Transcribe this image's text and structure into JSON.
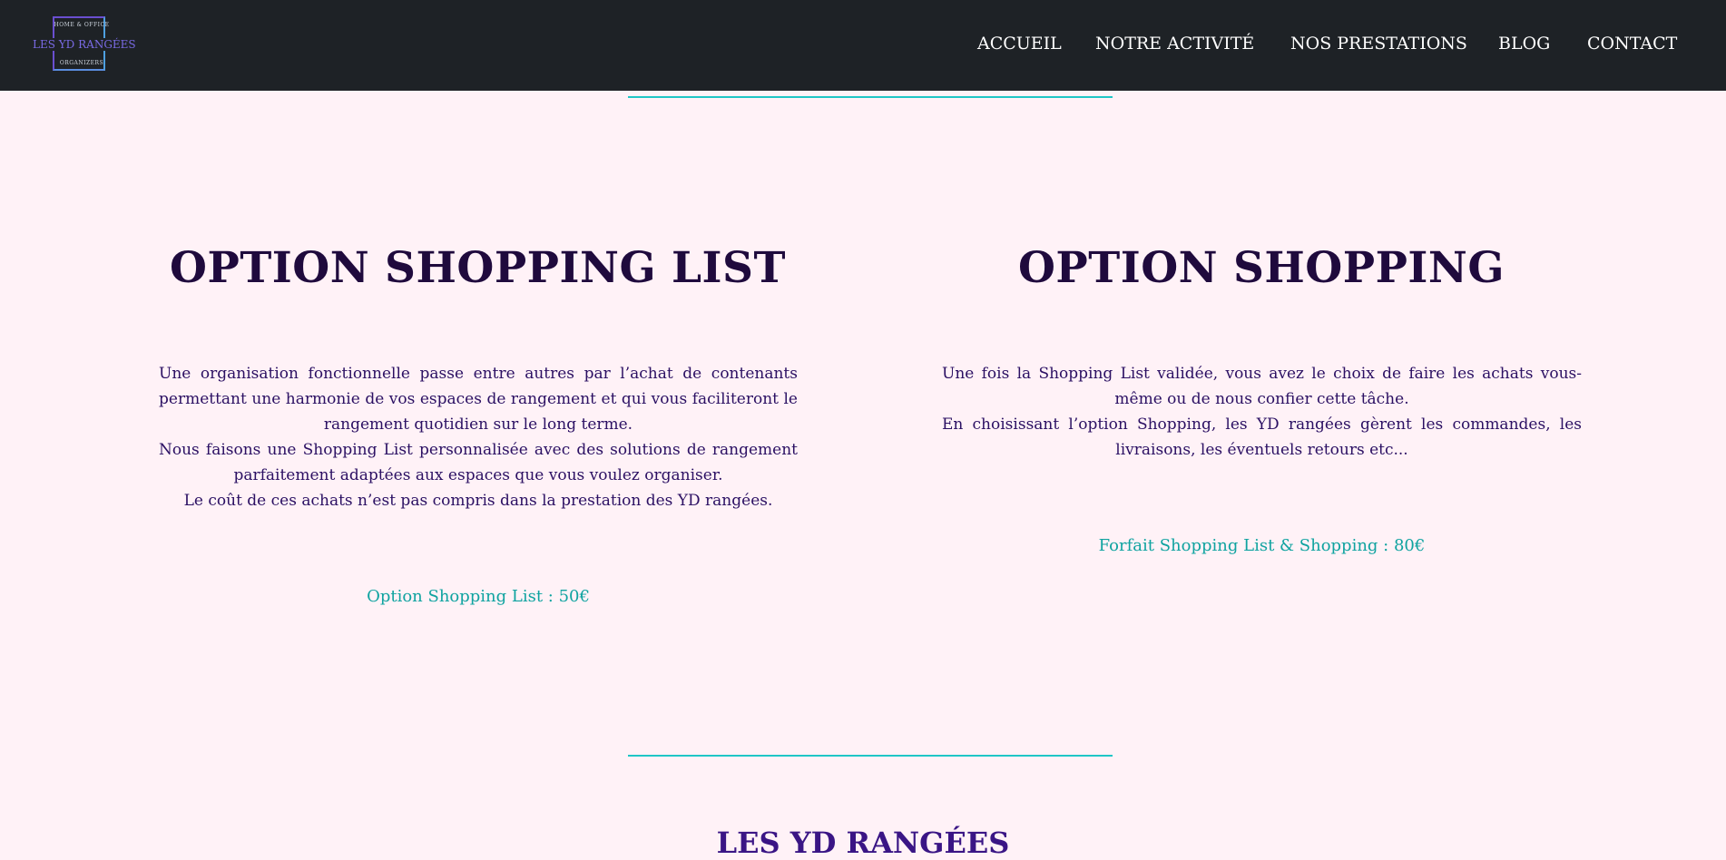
{
  "logo": {
    "top_text": "HOME & OFFICE",
    "main_text": "LES YD RANGÉES",
    "bottom_text": "ORGANIZERS"
  },
  "nav": {
    "items": [
      {
        "label": "ACCUEIL"
      },
      {
        "label": "NOTRE ACTIVITÉ"
      },
      {
        "label": "NOS PRESTATIONS"
      },
      {
        "label": "BLOG"
      },
      {
        "label": "CONTACT"
      }
    ]
  },
  "sections": [
    {
      "title": "OPTION SHOPPING LIST",
      "paragraphs": [
        "Une organisation fonctionnelle passe entre autres par l’achat de contenants permettant une harmonie de vos espaces de rangement et qui vous faciliteront le rangement quotidien sur le long terme.",
        "Nous faisons une Shopping List personnalisée avec des solutions de rangement parfaitement adaptées aux espaces que vous voulez organiser.",
        "Le coût de ces achats n’est pas compris dans la prestation des YD rangées."
      ],
      "price": "Option Shopping List : 50€"
    },
    {
      "title": "OPTION SHOPPING",
      "paragraphs": [
        "Une fois la Shopping List validée, vous avez le choix de faire les achats vous-même ou de nous confier cette tâche.",
        "En choisissant l’option Shopping, les YD rangées gèrent les commandes, les livraisons, les éventuels retours etc..."
      ],
      "price": "Forfait Shopping List & Shopping : 80€"
    }
  ],
  "next_section": {
    "title": "LES YD RANGÉES"
  },
  "colors": {
    "navbar_bg": "#1e2226",
    "page_bg": "#fff2f7",
    "accent_teal": "#1fc6c6",
    "title_color": "#1f0a3d",
    "text_color": "#2b1063",
    "price_color": "#0fa3a0"
  }
}
